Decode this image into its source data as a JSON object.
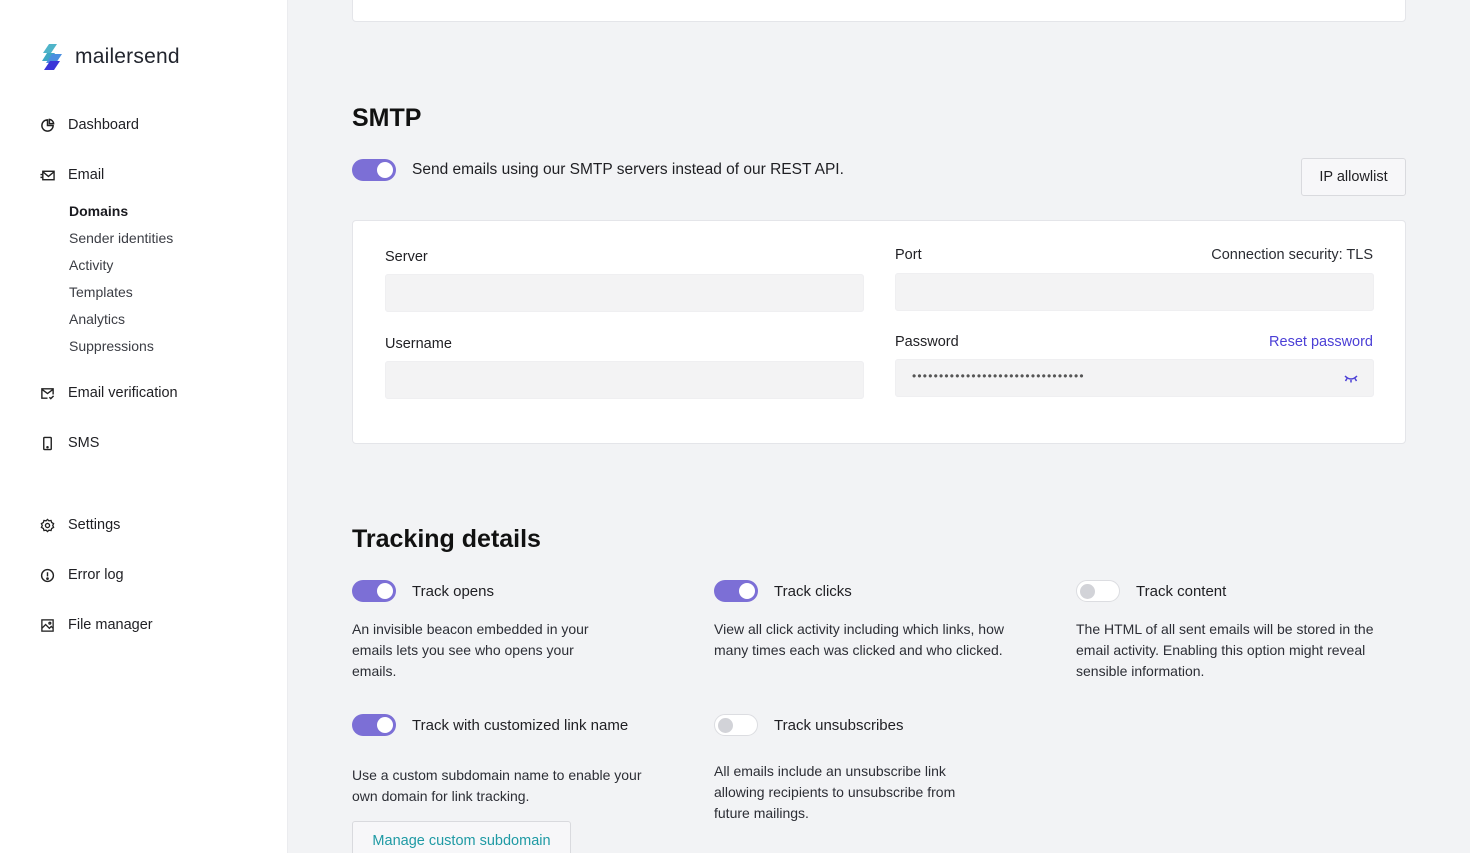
{
  "brand": {
    "name": "mailersend",
    "accent": "#7c6fd6",
    "link_color": "#4b3fd6",
    "teal": "#1f9aa4"
  },
  "sidebar": {
    "items": [
      {
        "label": "Dashboard",
        "icon": "dashboard-icon"
      },
      {
        "label": "Email",
        "icon": "email-icon"
      },
      {
        "label": "Email verification",
        "icon": "email-verification-icon"
      },
      {
        "label": "SMS",
        "icon": "phone-icon"
      },
      {
        "label": "Settings",
        "icon": "gear-icon"
      },
      {
        "label": "Error log",
        "icon": "error-icon"
      },
      {
        "label": "File manager",
        "icon": "image-icon"
      }
    ],
    "email_subitems": [
      {
        "label": "Domains",
        "active": true
      },
      {
        "label": "Sender identities"
      },
      {
        "label": "Activity"
      },
      {
        "label": "Templates"
      },
      {
        "label": "Analytics"
      },
      {
        "label": "Suppressions"
      }
    ]
  },
  "smtp": {
    "title": "SMTP",
    "enabled": true,
    "description": "Send emails using our SMTP servers instead of our REST API.",
    "ip_allowlist_label": "IP allowlist",
    "fields": {
      "server_label": "Server",
      "server_value": "",
      "port_label": "Port",
      "port_value": "",
      "connection_security": "Connection security: TLS",
      "username_label": "Username",
      "username_value": "",
      "password_label": "Password",
      "password_masked": "••••••••••••••••••••••••••••••••",
      "reset_password_label": "Reset password"
    }
  },
  "tracking": {
    "title": "Tracking details",
    "options": [
      {
        "label": "Track opens",
        "enabled": true,
        "description": "An invisible beacon embedded in your emails lets you see who opens your emails."
      },
      {
        "label": "Track clicks",
        "enabled": true,
        "description": "View all click activity including which links, how many times each was clicked and who clicked."
      },
      {
        "label": "Track content",
        "enabled": false,
        "description": "The HTML of all sent emails will be stored in the email activity. Enabling this option might reveal sensible information."
      },
      {
        "label": "Track with customized link name",
        "enabled": true,
        "description": "Use a custom subdomain name to enable your own domain for link tracking."
      },
      {
        "label": "Track unsubscribes",
        "enabled": false,
        "description": "All emails include an unsubscribe link allowing recipients to unsubscribe from future mailings."
      }
    ],
    "manage_subdomain_label": "Manage custom subdomain"
  }
}
